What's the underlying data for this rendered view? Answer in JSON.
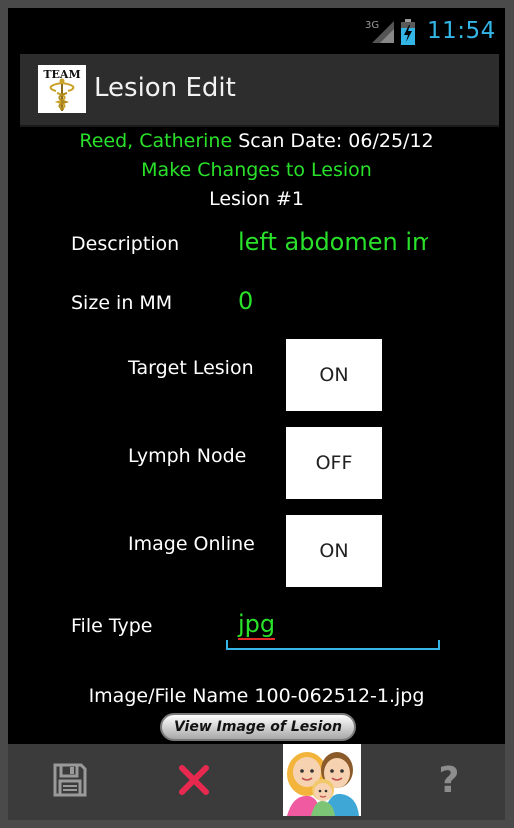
{
  "status_bar": {
    "network": "3G",
    "time": "11:54"
  },
  "action_bar": {
    "logo_text": "TEAM",
    "title": "Lesion Edit"
  },
  "header": {
    "patient_name": "Reed, Catherine",
    "scan_date": "Scan Date: 06/25/12",
    "instruction": "Make Changes to Lesion",
    "lesion_number": "Lesion #1"
  },
  "form": {
    "description_label": "Description",
    "description_value": "left abdomen im",
    "size_label": "Size in MM",
    "size_value": "0",
    "target_lesion_label": "Target Lesion",
    "target_lesion_state": "ON",
    "lymph_node_label": "Lymph Node",
    "lymph_node_state": "OFF",
    "image_online_label": "Image Online",
    "image_online_state": "ON",
    "file_type_label": "File Type",
    "file_type_value": "jpg",
    "file_name_text": "Image/File Name 100-062512-1.jpg",
    "view_image_label": "View Image of Lesion"
  },
  "bottom_bar": {
    "icons": [
      "save-icon",
      "delete-icon",
      "family-icon",
      "help-icon"
    ],
    "help_glyph": "?"
  },
  "colors": {
    "accent_green": "#29e02a",
    "holo_blue": "#33b5e5",
    "delete_red": "#e8294f"
  }
}
